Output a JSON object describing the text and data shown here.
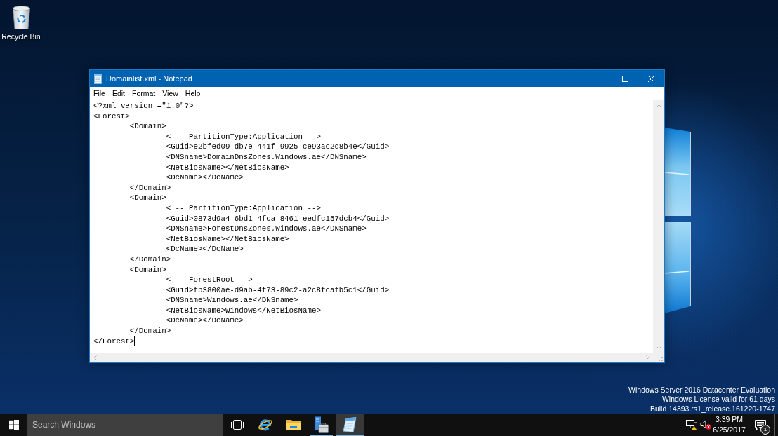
{
  "desktop": {
    "icons": [
      {
        "kind": "recycle-bin",
        "label": "Recycle Bin"
      }
    ],
    "watermark": [
      "Windows Server 2016 Datacenter Evaluation",
      "Windows License valid for 61 days",
      "Build 14393.rs1_release.161220-1747"
    ]
  },
  "window": {
    "title": "Domainlist.xml - Notepad",
    "menu": [
      "File",
      "Edit",
      "Format",
      "View",
      "Help"
    ],
    "document": [
      {
        "text": "<?xml version =\"1.0\"?>"
      },
      {
        "text": "<Forest>",
        "children": [
          {
            "text": "<Domain>",
            "children": [
              {
                "text": "<!-- PartitionType:Application -->"
              },
              {
                "text": "<Guid>e2bfed09-db7e-441f-9925-ce93ac2d8b4e</Guid>"
              },
              {
                "text": "<DNSname>DomainDnsZones.Windows.ae</DNSname>"
              },
              {
                "text": "<NetBiosName></NetBiosName>"
              },
              {
                "text": "<DcName></DcName>"
              }
            ]
          },
          {
            "text": "</Domain>"
          },
          {
            "text": "<Domain>",
            "children": [
              {
                "text": "<!-- PartitionType:Application -->"
              },
              {
                "text": "<Guid>0873d9a4-6bd1-4fca-8461-eedfc157dcb4</Guid>"
              },
              {
                "text": "<DNSname>ForestDnsZones.Windows.ae</DNSname>"
              },
              {
                "text": "<NetBiosName></NetBiosName>"
              },
              {
                "text": "<DcName></DcName>"
              }
            ]
          },
          {
            "text": "</Domain>"
          },
          {
            "text": "<Domain>",
            "children": [
              {
                "text": "<!-- ForestRoot -->"
              },
              {
                "text": "<Guid>fb3800ae-d9ab-4f73-89c2-a2c8fcafb5c1</Guid>"
              },
              {
                "text": "<DNSname>Windows.ae</DNSname>"
              },
              {
                "text": "<NetBiosName>Windows</NetBiosName>"
              },
              {
                "text": "<DcName></DcName>"
              }
            ]
          },
          {
            "text": "</Domain>"
          }
        ]
      },
      {
        "text": "</Forest>"
      }
    ],
    "caret": true
  },
  "taskbar": {
    "search": {
      "placeholder": "Search Windows"
    },
    "apps": [
      {
        "kind": "task-view",
        "running": false,
        "selected": false
      },
      {
        "kind": "browser",
        "running": false,
        "selected": false
      },
      {
        "kind": "file-explorer",
        "running": false,
        "selected": false
      },
      {
        "kind": "server-manager",
        "running": true,
        "selected": false
      },
      {
        "kind": "notepad",
        "running": true,
        "selected": true
      }
    ],
    "tray": {
      "network_warning": true,
      "volume_muted": true,
      "time": "3:39 PM",
      "date": "6/25/2017",
      "notification_count": "1"
    }
  }
}
